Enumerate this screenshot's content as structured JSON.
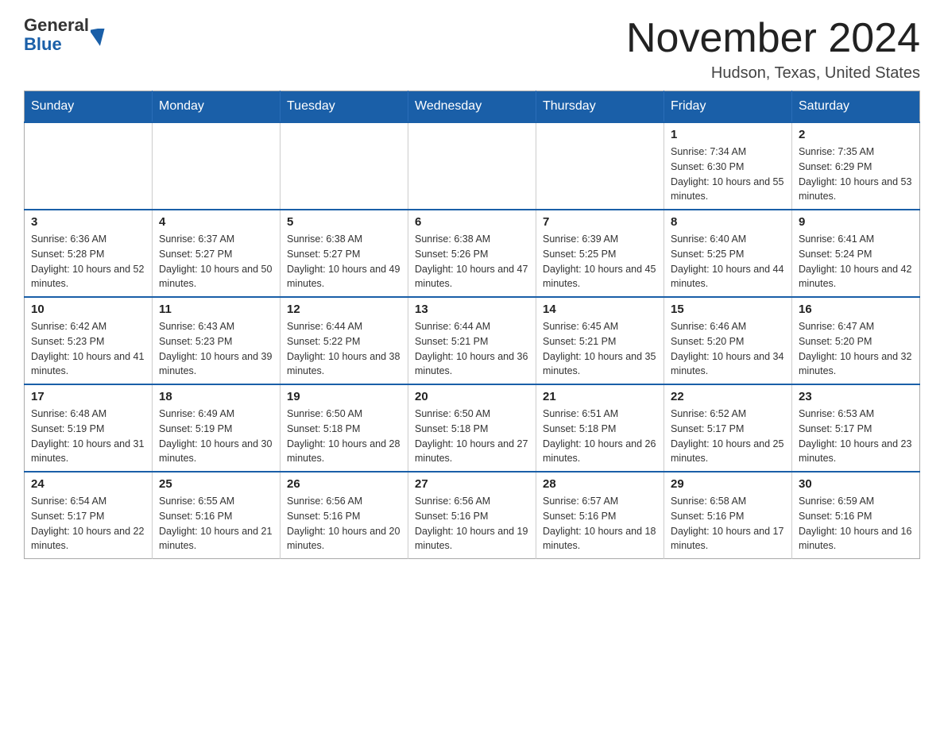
{
  "header": {
    "logo": {
      "general": "General",
      "blue": "Blue"
    },
    "title": "November 2024",
    "location": "Hudson, Texas, United States"
  },
  "calendar": {
    "weekdays": [
      "Sunday",
      "Monday",
      "Tuesday",
      "Wednesday",
      "Thursday",
      "Friday",
      "Saturday"
    ],
    "weeks": [
      [
        {
          "day": "",
          "info": ""
        },
        {
          "day": "",
          "info": ""
        },
        {
          "day": "",
          "info": ""
        },
        {
          "day": "",
          "info": ""
        },
        {
          "day": "",
          "info": ""
        },
        {
          "day": "1",
          "info": "Sunrise: 7:34 AM\nSunset: 6:30 PM\nDaylight: 10 hours and 55 minutes."
        },
        {
          "day": "2",
          "info": "Sunrise: 7:35 AM\nSunset: 6:29 PM\nDaylight: 10 hours and 53 minutes."
        }
      ],
      [
        {
          "day": "3",
          "info": "Sunrise: 6:36 AM\nSunset: 5:28 PM\nDaylight: 10 hours and 52 minutes."
        },
        {
          "day": "4",
          "info": "Sunrise: 6:37 AM\nSunset: 5:27 PM\nDaylight: 10 hours and 50 minutes."
        },
        {
          "day": "5",
          "info": "Sunrise: 6:38 AM\nSunset: 5:27 PM\nDaylight: 10 hours and 49 minutes."
        },
        {
          "day": "6",
          "info": "Sunrise: 6:38 AM\nSunset: 5:26 PM\nDaylight: 10 hours and 47 minutes."
        },
        {
          "day": "7",
          "info": "Sunrise: 6:39 AM\nSunset: 5:25 PM\nDaylight: 10 hours and 45 minutes."
        },
        {
          "day": "8",
          "info": "Sunrise: 6:40 AM\nSunset: 5:25 PM\nDaylight: 10 hours and 44 minutes."
        },
        {
          "day": "9",
          "info": "Sunrise: 6:41 AM\nSunset: 5:24 PM\nDaylight: 10 hours and 42 minutes."
        }
      ],
      [
        {
          "day": "10",
          "info": "Sunrise: 6:42 AM\nSunset: 5:23 PM\nDaylight: 10 hours and 41 minutes."
        },
        {
          "day": "11",
          "info": "Sunrise: 6:43 AM\nSunset: 5:23 PM\nDaylight: 10 hours and 39 minutes."
        },
        {
          "day": "12",
          "info": "Sunrise: 6:44 AM\nSunset: 5:22 PM\nDaylight: 10 hours and 38 minutes."
        },
        {
          "day": "13",
          "info": "Sunrise: 6:44 AM\nSunset: 5:21 PM\nDaylight: 10 hours and 36 minutes."
        },
        {
          "day": "14",
          "info": "Sunrise: 6:45 AM\nSunset: 5:21 PM\nDaylight: 10 hours and 35 minutes."
        },
        {
          "day": "15",
          "info": "Sunrise: 6:46 AM\nSunset: 5:20 PM\nDaylight: 10 hours and 34 minutes."
        },
        {
          "day": "16",
          "info": "Sunrise: 6:47 AM\nSunset: 5:20 PM\nDaylight: 10 hours and 32 minutes."
        }
      ],
      [
        {
          "day": "17",
          "info": "Sunrise: 6:48 AM\nSunset: 5:19 PM\nDaylight: 10 hours and 31 minutes."
        },
        {
          "day": "18",
          "info": "Sunrise: 6:49 AM\nSunset: 5:19 PM\nDaylight: 10 hours and 30 minutes."
        },
        {
          "day": "19",
          "info": "Sunrise: 6:50 AM\nSunset: 5:18 PM\nDaylight: 10 hours and 28 minutes."
        },
        {
          "day": "20",
          "info": "Sunrise: 6:50 AM\nSunset: 5:18 PM\nDaylight: 10 hours and 27 minutes."
        },
        {
          "day": "21",
          "info": "Sunrise: 6:51 AM\nSunset: 5:18 PM\nDaylight: 10 hours and 26 minutes."
        },
        {
          "day": "22",
          "info": "Sunrise: 6:52 AM\nSunset: 5:17 PM\nDaylight: 10 hours and 25 minutes."
        },
        {
          "day": "23",
          "info": "Sunrise: 6:53 AM\nSunset: 5:17 PM\nDaylight: 10 hours and 23 minutes."
        }
      ],
      [
        {
          "day": "24",
          "info": "Sunrise: 6:54 AM\nSunset: 5:17 PM\nDaylight: 10 hours and 22 minutes."
        },
        {
          "day": "25",
          "info": "Sunrise: 6:55 AM\nSunset: 5:16 PM\nDaylight: 10 hours and 21 minutes."
        },
        {
          "day": "26",
          "info": "Sunrise: 6:56 AM\nSunset: 5:16 PM\nDaylight: 10 hours and 20 minutes."
        },
        {
          "day": "27",
          "info": "Sunrise: 6:56 AM\nSunset: 5:16 PM\nDaylight: 10 hours and 19 minutes."
        },
        {
          "day": "28",
          "info": "Sunrise: 6:57 AM\nSunset: 5:16 PM\nDaylight: 10 hours and 18 minutes."
        },
        {
          "day": "29",
          "info": "Sunrise: 6:58 AM\nSunset: 5:16 PM\nDaylight: 10 hours and 17 minutes."
        },
        {
          "day": "30",
          "info": "Sunrise: 6:59 AM\nSunset: 5:16 PM\nDaylight: 10 hours and 16 minutes."
        }
      ]
    ]
  },
  "colors": {
    "header_bg": "#1a5fa8",
    "border": "#1a5fa8",
    "logo_blue": "#1a5fa8"
  }
}
